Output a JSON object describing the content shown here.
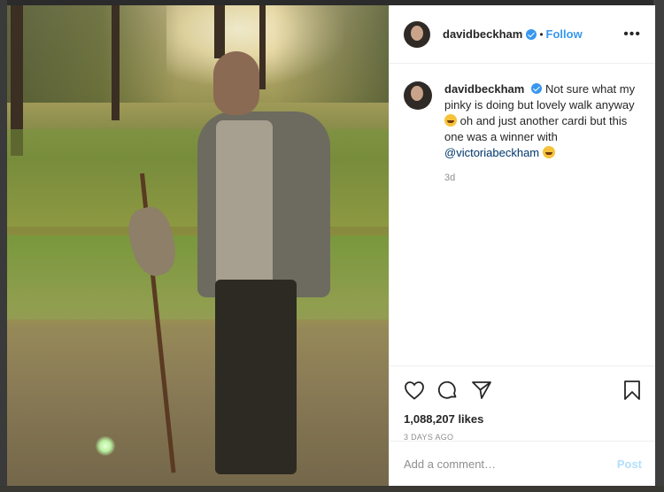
{
  "post": {
    "username": "davidbeckham",
    "follow_label": "Follow",
    "dot": "•",
    "more_label": "•••",
    "caption_text_1": "Not sure what my pinky is doing but lovely walk anyway",
    "caption_text_2": "oh and just another cardi but this one was a winner with",
    "mention": "@victoriabeckham",
    "caption_age": "3d",
    "likes": "1,088,207 likes",
    "date": "3 DAYS AGO"
  },
  "comment": {
    "placeholder": "Add a comment…",
    "post_label": "Post"
  },
  "colors": {
    "accent": "#3897f0",
    "post_disabled": "#b2dffc",
    "muted": "#8e8e8e"
  },
  "icons": {
    "like": "heart-icon",
    "comment": "comment-icon",
    "share": "paper-plane-icon",
    "save": "bookmark-icon"
  }
}
